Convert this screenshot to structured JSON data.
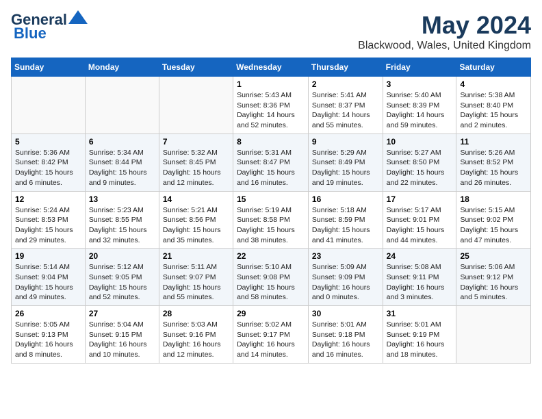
{
  "header": {
    "logo_line1": "General",
    "logo_line2": "Blue",
    "month": "May 2024",
    "location": "Blackwood, Wales, United Kingdom"
  },
  "days_of_week": [
    "Sunday",
    "Monday",
    "Tuesday",
    "Wednesday",
    "Thursday",
    "Friday",
    "Saturday"
  ],
  "weeks": [
    [
      {
        "num": "",
        "info": ""
      },
      {
        "num": "",
        "info": ""
      },
      {
        "num": "",
        "info": ""
      },
      {
        "num": "1",
        "info": "Sunrise: 5:43 AM\nSunset: 8:36 PM\nDaylight: 14 hours and 52 minutes."
      },
      {
        "num": "2",
        "info": "Sunrise: 5:41 AM\nSunset: 8:37 PM\nDaylight: 14 hours and 55 minutes."
      },
      {
        "num": "3",
        "info": "Sunrise: 5:40 AM\nSunset: 8:39 PM\nDaylight: 14 hours and 59 minutes."
      },
      {
        "num": "4",
        "info": "Sunrise: 5:38 AM\nSunset: 8:40 PM\nDaylight: 15 hours and 2 minutes."
      }
    ],
    [
      {
        "num": "5",
        "info": "Sunrise: 5:36 AM\nSunset: 8:42 PM\nDaylight: 15 hours and 6 minutes."
      },
      {
        "num": "6",
        "info": "Sunrise: 5:34 AM\nSunset: 8:44 PM\nDaylight: 15 hours and 9 minutes."
      },
      {
        "num": "7",
        "info": "Sunrise: 5:32 AM\nSunset: 8:45 PM\nDaylight: 15 hours and 12 minutes."
      },
      {
        "num": "8",
        "info": "Sunrise: 5:31 AM\nSunset: 8:47 PM\nDaylight: 15 hours and 16 minutes."
      },
      {
        "num": "9",
        "info": "Sunrise: 5:29 AM\nSunset: 8:49 PM\nDaylight: 15 hours and 19 minutes."
      },
      {
        "num": "10",
        "info": "Sunrise: 5:27 AM\nSunset: 8:50 PM\nDaylight: 15 hours and 22 minutes."
      },
      {
        "num": "11",
        "info": "Sunrise: 5:26 AM\nSunset: 8:52 PM\nDaylight: 15 hours and 26 minutes."
      }
    ],
    [
      {
        "num": "12",
        "info": "Sunrise: 5:24 AM\nSunset: 8:53 PM\nDaylight: 15 hours and 29 minutes."
      },
      {
        "num": "13",
        "info": "Sunrise: 5:23 AM\nSunset: 8:55 PM\nDaylight: 15 hours and 32 minutes."
      },
      {
        "num": "14",
        "info": "Sunrise: 5:21 AM\nSunset: 8:56 PM\nDaylight: 15 hours and 35 minutes."
      },
      {
        "num": "15",
        "info": "Sunrise: 5:19 AM\nSunset: 8:58 PM\nDaylight: 15 hours and 38 minutes."
      },
      {
        "num": "16",
        "info": "Sunrise: 5:18 AM\nSunset: 8:59 PM\nDaylight: 15 hours and 41 minutes."
      },
      {
        "num": "17",
        "info": "Sunrise: 5:17 AM\nSunset: 9:01 PM\nDaylight: 15 hours and 44 minutes."
      },
      {
        "num": "18",
        "info": "Sunrise: 5:15 AM\nSunset: 9:02 PM\nDaylight: 15 hours and 47 minutes."
      }
    ],
    [
      {
        "num": "19",
        "info": "Sunrise: 5:14 AM\nSunset: 9:04 PM\nDaylight: 15 hours and 49 minutes."
      },
      {
        "num": "20",
        "info": "Sunrise: 5:12 AM\nSunset: 9:05 PM\nDaylight: 15 hours and 52 minutes."
      },
      {
        "num": "21",
        "info": "Sunrise: 5:11 AM\nSunset: 9:07 PM\nDaylight: 15 hours and 55 minutes."
      },
      {
        "num": "22",
        "info": "Sunrise: 5:10 AM\nSunset: 9:08 PM\nDaylight: 15 hours and 58 minutes."
      },
      {
        "num": "23",
        "info": "Sunrise: 5:09 AM\nSunset: 9:09 PM\nDaylight: 16 hours and 0 minutes."
      },
      {
        "num": "24",
        "info": "Sunrise: 5:08 AM\nSunset: 9:11 PM\nDaylight: 16 hours and 3 minutes."
      },
      {
        "num": "25",
        "info": "Sunrise: 5:06 AM\nSunset: 9:12 PM\nDaylight: 16 hours and 5 minutes."
      }
    ],
    [
      {
        "num": "26",
        "info": "Sunrise: 5:05 AM\nSunset: 9:13 PM\nDaylight: 16 hours and 8 minutes."
      },
      {
        "num": "27",
        "info": "Sunrise: 5:04 AM\nSunset: 9:15 PM\nDaylight: 16 hours and 10 minutes."
      },
      {
        "num": "28",
        "info": "Sunrise: 5:03 AM\nSunset: 9:16 PM\nDaylight: 16 hours and 12 minutes."
      },
      {
        "num": "29",
        "info": "Sunrise: 5:02 AM\nSunset: 9:17 PM\nDaylight: 16 hours and 14 minutes."
      },
      {
        "num": "30",
        "info": "Sunrise: 5:01 AM\nSunset: 9:18 PM\nDaylight: 16 hours and 16 minutes."
      },
      {
        "num": "31",
        "info": "Sunrise: 5:01 AM\nSunset: 9:19 PM\nDaylight: 16 hours and 18 minutes."
      },
      {
        "num": "",
        "info": ""
      }
    ]
  ]
}
